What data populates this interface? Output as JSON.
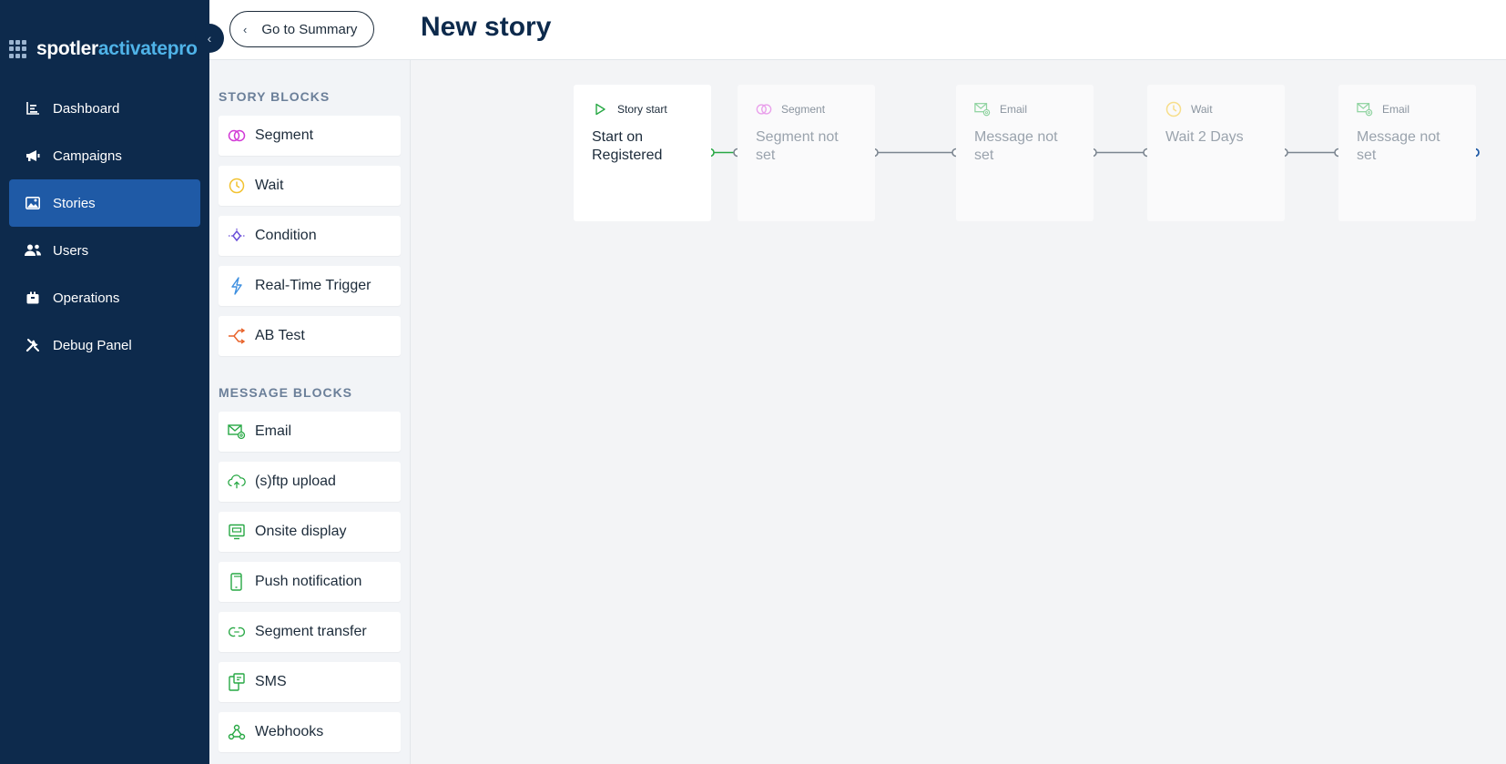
{
  "brand": {
    "part1": "spotler",
    "part2": "activatepro"
  },
  "nav": {
    "items": [
      {
        "label": "Dashboard",
        "icon": "chart-bars-icon"
      },
      {
        "label": "Campaigns",
        "icon": "megaphone-icon"
      },
      {
        "label": "Stories",
        "icon": "image-icon",
        "active": true
      },
      {
        "label": "Users",
        "icon": "users-icon"
      },
      {
        "label": "Operations",
        "icon": "box-icon"
      },
      {
        "label": "Debug Panel",
        "icon": "tools-icon"
      }
    ]
  },
  "header": {
    "back_label": "Go to Summary",
    "title": "New story"
  },
  "panel": {
    "story_title": "STORY BLOCKS",
    "story_blocks": [
      "Segment",
      "Wait",
      "Condition",
      "Real-Time Trigger",
      "AB Test"
    ],
    "message_title": "MESSAGE BLOCKS",
    "message_blocks": [
      "Email",
      "(s)ftp upload",
      "Onsite display",
      "Push notification",
      "Segment transfer",
      "SMS",
      "Webhooks"
    ]
  },
  "flow": {
    "nodes": [
      {
        "type": "Story start",
        "text": "Start on Registered"
      },
      {
        "type": "Segment",
        "text": "Segment not set"
      },
      {
        "type": "Email",
        "text": "Message not set"
      },
      {
        "type": "Wait",
        "text": "Wait 2 Days"
      },
      {
        "type": "Email",
        "text": "Message not set"
      }
    ]
  },
  "colors": {
    "nav_bg": "#0d2a4c",
    "nav_active": "#1f5aa6",
    "brand_accent": "#4fb3e8",
    "segment": "#d23ad6",
    "wait": "#f2c230",
    "condition": "#6a4fd8",
    "trigger": "#3d8fe0",
    "abtest": "#e8632b",
    "message": "#27a844",
    "connector": "#7b8590"
  }
}
